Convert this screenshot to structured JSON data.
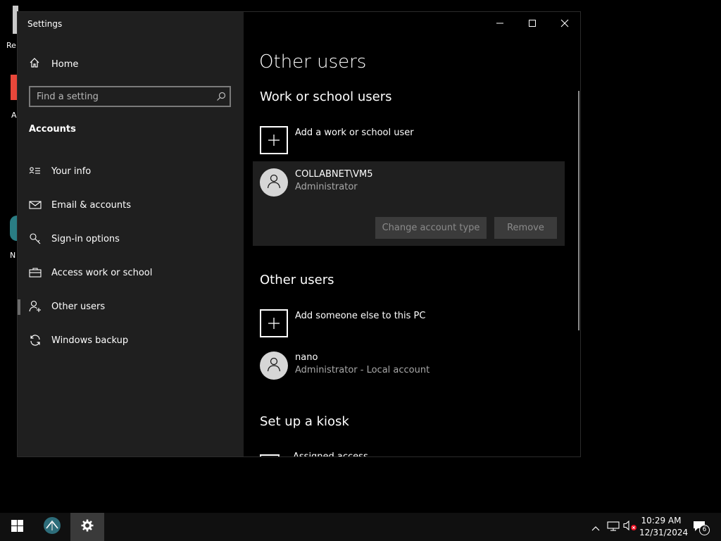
{
  "desktop": {
    "label_1": "Re",
    "label_2": "A",
    "label_3": "N"
  },
  "window": {
    "title": "Settings",
    "controls": {
      "minimize": "minimize",
      "maximize": "maximize",
      "close": "close"
    }
  },
  "sidebar": {
    "home_label": "Home",
    "search_placeholder": "Find a setting",
    "section_title": "Accounts",
    "items": [
      {
        "label": "Your info",
        "icon": "person-card-icon"
      },
      {
        "label": "Email & accounts",
        "icon": "envelope-icon"
      },
      {
        "label": "Sign-in options",
        "icon": "key-icon"
      },
      {
        "label": "Access work or school",
        "icon": "briefcase-icon"
      },
      {
        "label": "Other users",
        "icon": "person-add-icon",
        "active": true
      },
      {
        "label": "Windows backup",
        "icon": "sync-icon"
      }
    ]
  },
  "main": {
    "page_title": "Other users",
    "work_school": {
      "heading": "Work or school users",
      "add_label": "Add a work or school user",
      "user": {
        "name": "COLLABNET\\VM5",
        "role": "Administrator",
        "change_button": "Change account type",
        "remove_button": "Remove"
      }
    },
    "other_users": {
      "heading": "Other users",
      "add_label": "Add someone else to this PC",
      "user": {
        "name": "nano",
        "role": "Administrator - Local account"
      }
    },
    "kiosk": {
      "heading": "Set up a kiosk",
      "item_label": "Assigned access"
    }
  },
  "taskbar": {
    "time": "10:29 AM",
    "date": "12/31/2024",
    "notification_count": "6"
  },
  "colors": {
    "sidebar_bg": "#1f1f1f",
    "main_bg": "#000000",
    "card_bg": "#1f1f1f",
    "disabled_button_bg": "#3b3b3b",
    "taskbar_bg": "#101010"
  }
}
